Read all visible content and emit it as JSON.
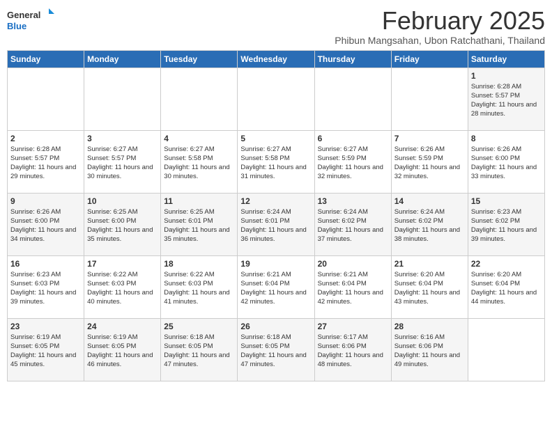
{
  "logo": {
    "general": "General",
    "blue": "Blue"
  },
  "title": "February 2025",
  "location": "Phibun Mangsahan, Ubon Ratchathani, Thailand",
  "weekdays": [
    "Sunday",
    "Monday",
    "Tuesday",
    "Wednesday",
    "Thursday",
    "Friday",
    "Saturday"
  ],
  "weeks": [
    [
      null,
      null,
      null,
      null,
      null,
      null,
      {
        "day": "1",
        "sunrise": "6:28 AM",
        "sunset": "5:57 PM",
        "daylight": "11 hours and 28 minutes."
      }
    ],
    [
      {
        "day": "2",
        "sunrise": "6:28 AM",
        "sunset": "5:57 PM",
        "daylight": "11 hours and 29 minutes."
      },
      {
        "day": "3",
        "sunrise": "6:27 AM",
        "sunset": "5:57 PM",
        "daylight": "11 hours and 30 minutes."
      },
      {
        "day": "4",
        "sunrise": "6:27 AM",
        "sunset": "5:58 PM",
        "daylight": "11 hours and 30 minutes."
      },
      {
        "day": "5",
        "sunrise": "6:27 AM",
        "sunset": "5:58 PM",
        "daylight": "11 hours and 31 minutes."
      },
      {
        "day": "6",
        "sunrise": "6:27 AM",
        "sunset": "5:59 PM",
        "daylight": "11 hours and 32 minutes."
      },
      {
        "day": "7",
        "sunrise": "6:26 AM",
        "sunset": "5:59 PM",
        "daylight": "11 hours and 32 minutes."
      },
      {
        "day": "8",
        "sunrise": "6:26 AM",
        "sunset": "6:00 PM",
        "daylight": "11 hours and 33 minutes."
      }
    ],
    [
      {
        "day": "9",
        "sunrise": "6:26 AM",
        "sunset": "6:00 PM",
        "daylight": "11 hours and 34 minutes."
      },
      {
        "day": "10",
        "sunrise": "6:25 AM",
        "sunset": "6:00 PM",
        "daylight": "11 hours and 35 minutes."
      },
      {
        "day": "11",
        "sunrise": "6:25 AM",
        "sunset": "6:01 PM",
        "daylight": "11 hours and 35 minutes."
      },
      {
        "day": "12",
        "sunrise": "6:24 AM",
        "sunset": "6:01 PM",
        "daylight": "11 hours and 36 minutes."
      },
      {
        "day": "13",
        "sunrise": "6:24 AM",
        "sunset": "6:02 PM",
        "daylight": "11 hours and 37 minutes."
      },
      {
        "day": "14",
        "sunrise": "6:24 AM",
        "sunset": "6:02 PM",
        "daylight": "11 hours and 38 minutes."
      },
      {
        "day": "15",
        "sunrise": "6:23 AM",
        "sunset": "6:02 PM",
        "daylight": "11 hours and 39 minutes."
      }
    ],
    [
      {
        "day": "16",
        "sunrise": "6:23 AM",
        "sunset": "6:03 PM",
        "daylight": "11 hours and 39 minutes."
      },
      {
        "day": "17",
        "sunrise": "6:22 AM",
        "sunset": "6:03 PM",
        "daylight": "11 hours and 40 minutes."
      },
      {
        "day": "18",
        "sunrise": "6:22 AM",
        "sunset": "6:03 PM",
        "daylight": "11 hours and 41 minutes."
      },
      {
        "day": "19",
        "sunrise": "6:21 AM",
        "sunset": "6:04 PM",
        "daylight": "11 hours and 42 minutes."
      },
      {
        "day": "20",
        "sunrise": "6:21 AM",
        "sunset": "6:04 PM",
        "daylight": "11 hours and 42 minutes."
      },
      {
        "day": "21",
        "sunrise": "6:20 AM",
        "sunset": "6:04 PM",
        "daylight": "11 hours and 43 minutes."
      },
      {
        "day": "22",
        "sunrise": "6:20 AM",
        "sunset": "6:04 PM",
        "daylight": "11 hours and 44 minutes."
      }
    ],
    [
      {
        "day": "23",
        "sunrise": "6:19 AM",
        "sunset": "6:05 PM",
        "daylight": "11 hours and 45 minutes."
      },
      {
        "day": "24",
        "sunrise": "6:19 AM",
        "sunset": "6:05 PM",
        "daylight": "11 hours and 46 minutes."
      },
      {
        "day": "25",
        "sunrise": "6:18 AM",
        "sunset": "6:05 PM",
        "daylight": "11 hours and 47 minutes."
      },
      {
        "day": "26",
        "sunrise": "6:18 AM",
        "sunset": "6:05 PM",
        "daylight": "11 hours and 47 minutes."
      },
      {
        "day": "27",
        "sunrise": "6:17 AM",
        "sunset": "6:06 PM",
        "daylight": "11 hours and 48 minutes."
      },
      {
        "day": "28",
        "sunrise": "6:16 AM",
        "sunset": "6:06 PM",
        "daylight": "11 hours and 49 minutes."
      },
      null
    ]
  ]
}
